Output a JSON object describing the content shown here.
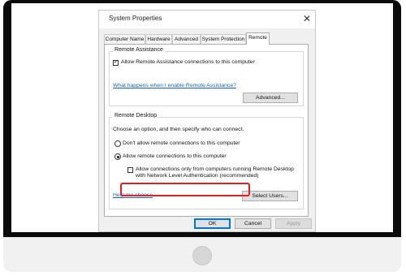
{
  "dialog": {
    "title": "System Properties",
    "tabs": [
      "Computer Name",
      "Hardware",
      "Advanced",
      "System Protection",
      "Remote"
    ],
    "active_tab": "Remote"
  },
  "remote_assistance": {
    "group_label": "Remote Assistance",
    "allow_label": "Allow Remote Assistance connections to this computer",
    "allow_checked": true,
    "help_link": "What happens when I enable Remote Assistance?",
    "advanced_button": "Advanced..."
  },
  "remote_desktop": {
    "group_label": "Remote Desktop",
    "instruction": "Choose an option, and then specify who can connect.",
    "options": [
      {
        "label": "Don't allow remote connections to this computer",
        "selected": false
      },
      {
        "label": "Allow remote connections to this computer",
        "selected": true
      }
    ],
    "nla_label_line1": "Allow connections only from computers running Remote Desktop",
    "nla_label_line2": "with Network Level Authentication (recommended)",
    "nla_checked": false,
    "help_link": "Help me choose",
    "select_users_button": "Select Users..."
  },
  "footer": {
    "ok": "OK",
    "cancel": "Cancel",
    "apply": "Apply"
  },
  "colors": {
    "highlight": "#e02020",
    "link": "#1565c0",
    "default_button_border": "#0078d7"
  }
}
